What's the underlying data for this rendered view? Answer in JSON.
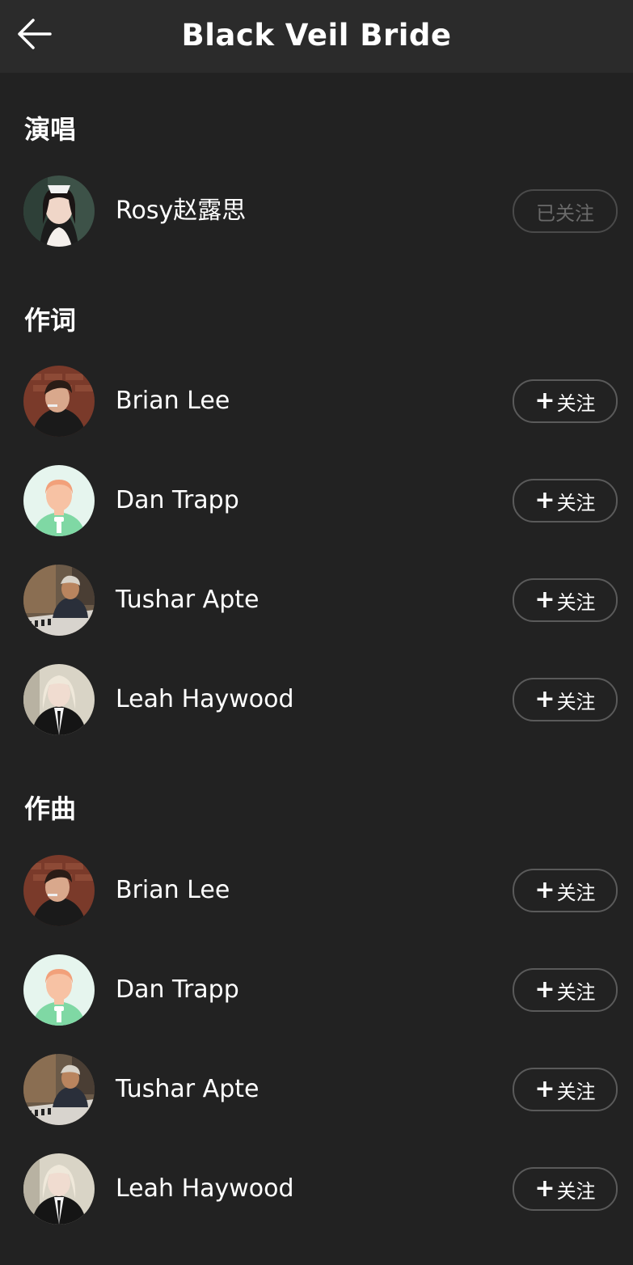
{
  "header": {
    "title": "Black Veil Bride",
    "back_icon": "arrow-left-icon"
  },
  "sections": [
    {
      "title": "演唱",
      "members": [
        {
          "name": "Rosy赵露思",
          "button": "已关注",
          "followed": true,
          "avatar": "rosy"
        }
      ]
    },
    {
      "title": "作词",
      "members": [
        {
          "name": "Brian Lee",
          "button": "关注",
          "followed": false,
          "avatar": "brian"
        },
        {
          "name": "Dan Trapp",
          "button": "关注",
          "followed": false,
          "avatar": "default"
        },
        {
          "name": "Tushar Apte",
          "button": "关注",
          "followed": false,
          "avatar": "tushar"
        },
        {
          "name": "Leah Haywood",
          "button": "关注",
          "followed": false,
          "avatar": "leah"
        }
      ]
    },
    {
      "title": "作曲",
      "members": [
        {
          "name": "Brian Lee",
          "button": "关注",
          "followed": false,
          "avatar": "brian"
        },
        {
          "name": "Dan Trapp",
          "button": "关注",
          "followed": false,
          "avatar": "default"
        },
        {
          "name": "Tushar Apte",
          "button": "关注",
          "followed": false,
          "avatar": "tushar"
        },
        {
          "name": "Leah Haywood",
          "button": "关注",
          "followed": false,
          "avatar": "leah"
        }
      ]
    }
  ],
  "colors": {
    "background": "#222222",
    "header_background": "#2b2b2b",
    "button_border": "#5a5a5a",
    "followed_text": "#6a6a6a"
  }
}
